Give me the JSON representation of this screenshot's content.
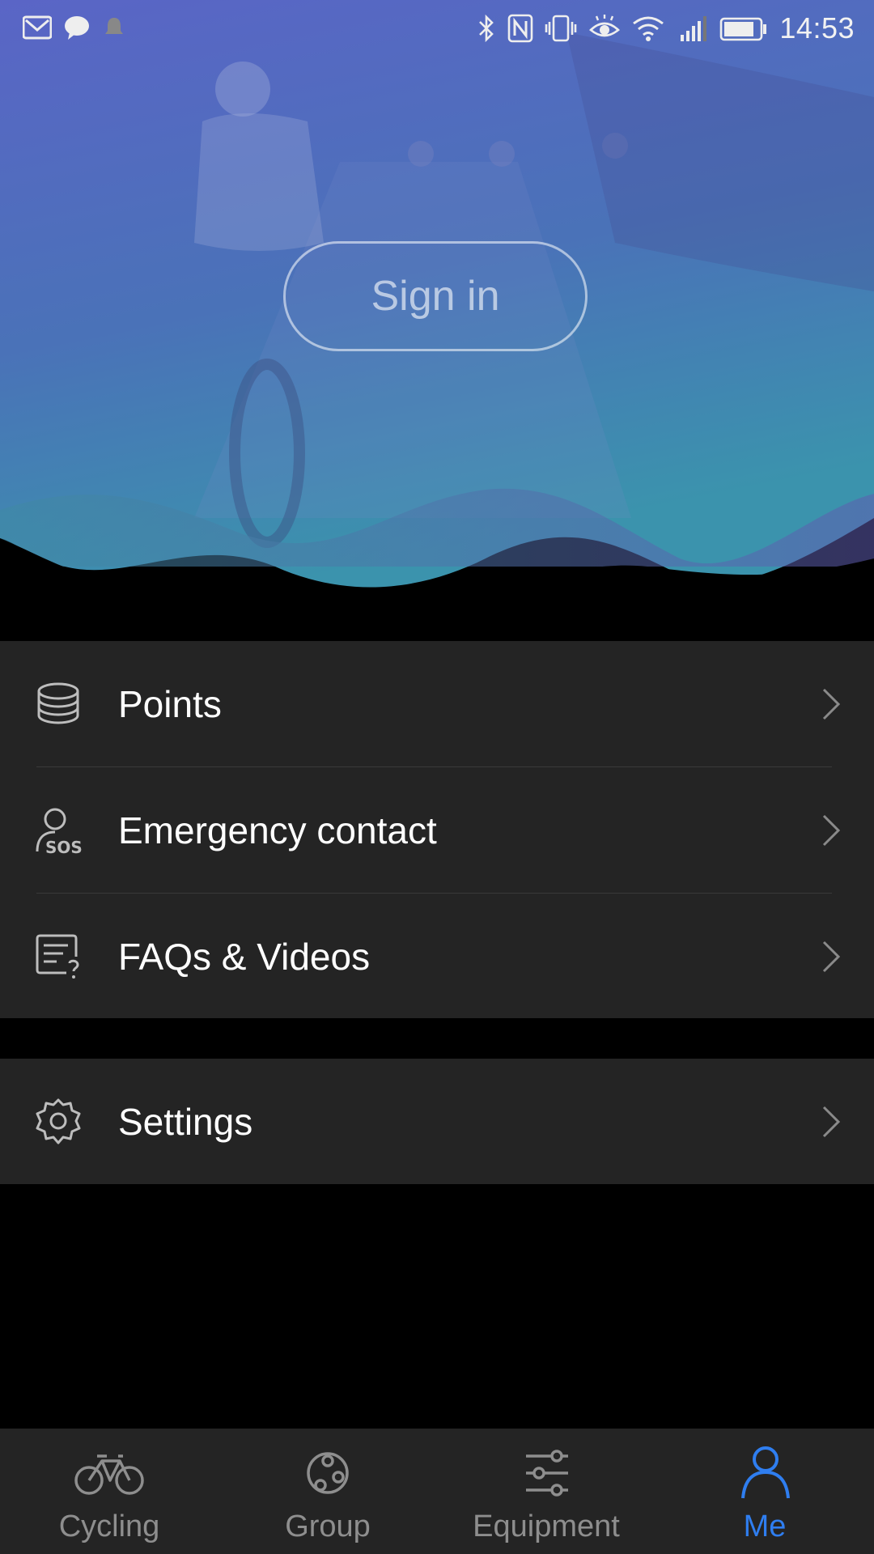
{
  "status_bar": {
    "time": "14:53",
    "left_icons": [
      "mail-icon",
      "message-icon",
      "notification-icon"
    ],
    "right_icons": [
      "bluetooth-icon",
      "nfc-icon",
      "vibrate-icon",
      "eye-comfort-icon",
      "wifi-icon",
      "signal-icon",
      "battery-icon"
    ]
  },
  "hero": {
    "sign_in_label": "Sign in"
  },
  "menu": {
    "items": [
      {
        "label": "Points",
        "icon": "coins-icon"
      },
      {
        "label": "Emergency contact",
        "icon": "sos-contact-icon",
        "icon_text": "SOS"
      },
      {
        "label": "FAQs & Videos",
        "icon": "faq-document-icon"
      }
    ],
    "settings": {
      "label": "Settings",
      "icon": "gear-icon"
    }
  },
  "bottom_nav": {
    "items": [
      {
        "label": "Cycling",
        "icon": "bicycle-icon"
      },
      {
        "label": "Group",
        "icon": "group-icon"
      },
      {
        "label": "Equipment",
        "icon": "sliders-icon"
      },
      {
        "label": "Me",
        "icon": "person-icon"
      }
    ],
    "active": "Me"
  },
  "colors": {
    "accent": "#2f7ef0",
    "panel": "#242424",
    "background": "#000000",
    "hero_top": "#5a5fc0",
    "hero_bottom": "#3c8fae"
  }
}
